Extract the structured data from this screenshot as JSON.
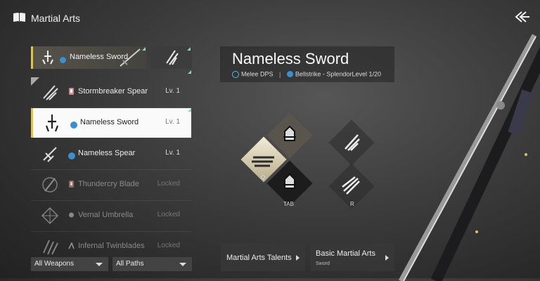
{
  "header": {
    "title": "Martial Arts"
  },
  "equipped": {
    "label": "Nameless Sword"
  },
  "weapons": [
    {
      "name": "Stormbreaker Spear",
      "level": "Lv. 1",
      "state": "normal"
    },
    {
      "name": "Nameless Sword",
      "level": "Lv. 1",
      "state": "selected"
    },
    {
      "name": "Nameless Spear",
      "level": "Lv. 1",
      "state": "normal"
    },
    {
      "name": "Thundercry Blade",
      "level": "Locked",
      "state": "locked"
    },
    {
      "name": "Vernal Umbrella",
      "level": "Locked",
      "state": "locked"
    },
    {
      "name": "Infernal Twinblades",
      "level": "Locked",
      "state": "locked"
    }
  ],
  "filters": {
    "weapons": "All Weapons",
    "paths": "All Paths"
  },
  "detail": {
    "title": "Nameless Sword",
    "role": "Melee DPS",
    "sep": "|",
    "path": "Bellstrike - Splendor",
    "level": "Level 1/20"
  },
  "skills": {
    "key_q": "Q",
    "key_tab": "TAB",
    "key_r": "R"
  },
  "buttons": {
    "talents": "Martial Arts Talents",
    "basic": "Basic Martial Arts",
    "basic_sub": "Sword"
  },
  "colors": {
    "accent_gold": "#d9c266",
    "accent_green": "#8ad7b9",
    "path_blue": "#3b8fd0"
  }
}
